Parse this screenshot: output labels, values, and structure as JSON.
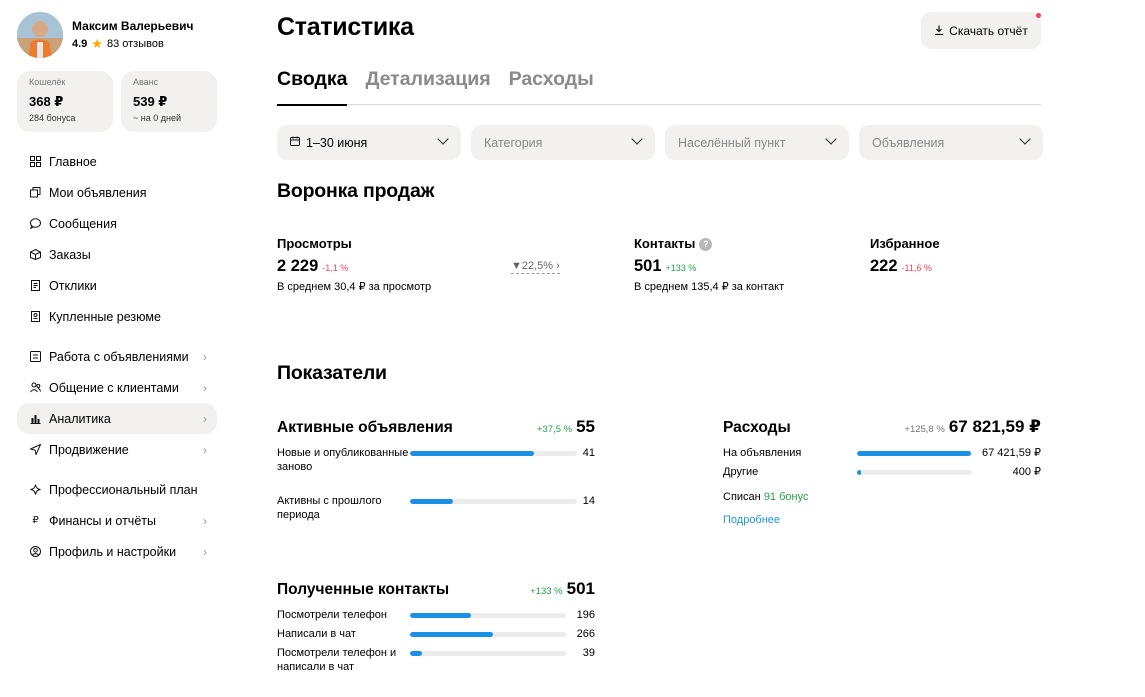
{
  "profile": {
    "name": "Максим Валерьевич",
    "rating": "4.9",
    "reviews": "83 отзывов"
  },
  "wallets": [
    {
      "title": "Кошелёк",
      "amount": "368 ₽",
      "sub": "284 бонуса"
    },
    {
      "title": "Аванс",
      "amount": "539 ₽",
      "sub": "~ на 0 дней"
    }
  ],
  "nav": {
    "group1": [
      {
        "label": "Главное",
        "icon": "grid-icon"
      },
      {
        "label": "Мои объявления",
        "icon": "copy-icon"
      },
      {
        "label": "Сообщения",
        "icon": "chat-icon"
      },
      {
        "label": "Заказы",
        "icon": "box-icon"
      },
      {
        "label": "Отклики",
        "icon": "document-icon"
      },
      {
        "label": "Купленные резюме",
        "icon": "resume-icon"
      }
    ],
    "group2": [
      {
        "label": "Работа с объявлениями",
        "icon": "work-icon"
      },
      {
        "label": "Общение с клиентами",
        "icon": "people-icon"
      },
      {
        "label": "Аналитика",
        "icon": "chart-icon",
        "active": true
      },
      {
        "label": "Продвижение",
        "icon": "send-icon"
      }
    ],
    "group3": [
      {
        "label": "Профессиональный план",
        "icon": "sparkle-icon"
      },
      {
        "label": "Финансы и отчёты",
        "icon": "ruble-icon"
      },
      {
        "label": "Профиль и настройки",
        "icon": "user-icon"
      }
    ]
  },
  "page": {
    "title": "Статистика",
    "download_label": "Скачать отчёт",
    "tabs": [
      "Сводка",
      "Детализация",
      "Расходы"
    ]
  },
  "filters": {
    "period": "1–30 июня",
    "category_placeholder": "Категория",
    "city_placeholder": "Населённый пункт",
    "ads_placeholder": "Объявления"
  },
  "funnel": {
    "title": "Воронка продаж",
    "views": {
      "label": "Просмотры",
      "value": "2 229",
      "delta": "-1,1 %",
      "sub": "В среднем 30,4 ₽ за просмотр"
    },
    "conversion": "22,5%",
    "contacts": {
      "label": "Контакты",
      "value": "501",
      "delta": "+133 %",
      "sub": "В среднем 135,4 ₽ за контакт"
    },
    "favorites": {
      "label": "Избранное",
      "value": "222",
      "delta": "-11,6 %"
    }
  },
  "metrics": {
    "title": "Показатели",
    "active_ads": {
      "title": "Активные объявления",
      "delta": "+37,5 %",
      "total": "55",
      "rows": [
        {
          "label": "Новые и опубликованные заново",
          "value": "41",
          "fraction": 0.745
        },
        {
          "label": "Активны с прошлого периода",
          "value": "14",
          "fraction": 0.255
        }
      ]
    },
    "expenses": {
      "title": "Расходы",
      "delta": "+125,8 %",
      "total": "67 821,59 ₽",
      "rows": [
        {
          "label": "На объявления",
          "value": "67 421,59 ₽",
          "fraction": 0.994
        },
        {
          "label": "Другие",
          "value": "400 ₽",
          "fraction": 0.006
        }
      ],
      "written_off_label": "Списан",
      "written_off_bonus": "91 бонус",
      "more_link": "Подробнее"
    },
    "contacts": {
      "title": "Полученные контакты",
      "delta": "+133 %",
      "total": "501",
      "rows": [
        {
          "label": "Посмотрели телефон",
          "value": "196",
          "fraction": 0.391
        },
        {
          "label": "Написали в чат",
          "value": "266",
          "fraction": 0.531
        },
        {
          "label": "Посмотрели телефон и написали в чат",
          "value": "39",
          "fraction": 0.078
        }
      ]
    }
  },
  "colors": {
    "accent_blue": "#1992e6",
    "negative": "#ff4053",
    "positive": "#2aa14a",
    "link": "#1a9ad6",
    "surface": "#f2f1f0"
  }
}
